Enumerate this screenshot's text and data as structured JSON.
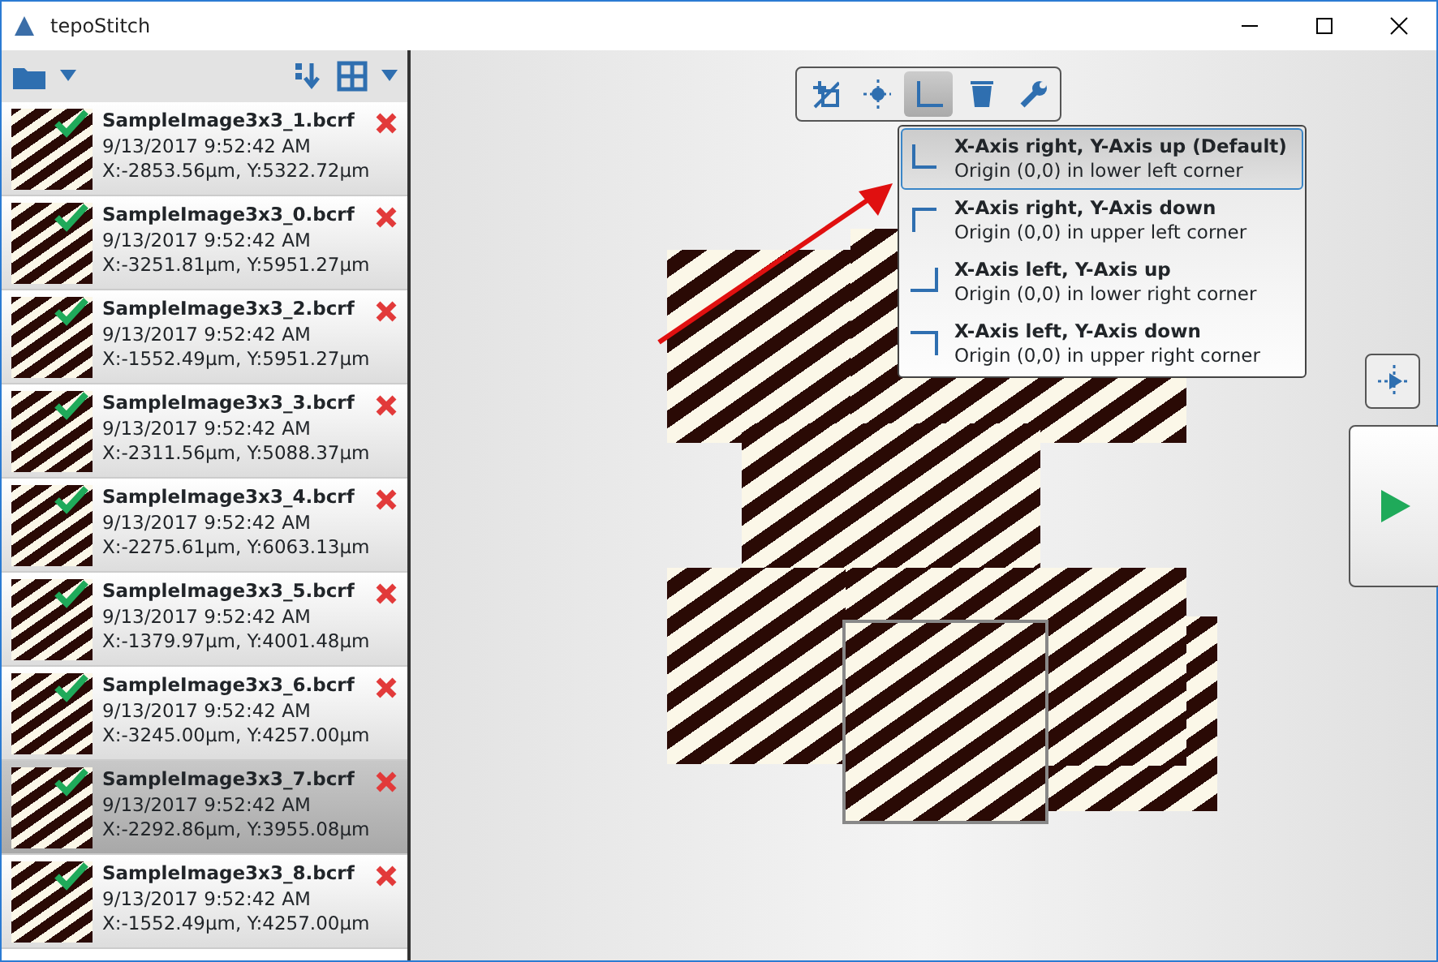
{
  "window": {
    "title": "tepoStitch"
  },
  "images": [
    {
      "name": "SampleImage3x3_1.bcrf",
      "date": "9/13/2017 9:52:42 AM",
      "position": "X:-2853.56µm, Y:5322.72µm",
      "checked": true,
      "selected": false
    },
    {
      "name": "SampleImage3x3_0.bcrf",
      "date": "9/13/2017 9:52:42 AM",
      "position": "X:-3251.81µm, Y:5951.27µm",
      "checked": true,
      "selected": false
    },
    {
      "name": "SampleImage3x3_2.bcrf",
      "date": "9/13/2017 9:52:42 AM",
      "position": "X:-1552.49µm, Y:5951.27µm",
      "checked": true,
      "selected": false
    },
    {
      "name": "SampleImage3x3_3.bcrf",
      "date": "9/13/2017 9:52:42 AM",
      "position": "X:-2311.56µm, Y:5088.37µm",
      "checked": true,
      "selected": false
    },
    {
      "name": "SampleImage3x3_4.bcrf",
      "date": "9/13/2017 9:52:42 AM",
      "position": "X:-2275.61µm, Y:6063.13µm",
      "checked": true,
      "selected": false
    },
    {
      "name": "SampleImage3x3_5.bcrf",
      "date": "9/13/2017 9:52:42 AM",
      "position": "X:-1379.97µm, Y:4001.48µm",
      "checked": true,
      "selected": false
    },
    {
      "name": "SampleImage3x3_6.bcrf",
      "date": "9/13/2017 9:52:42 AM",
      "position": "X:-3245.00µm, Y:4257.00µm",
      "checked": true,
      "selected": false
    },
    {
      "name": "SampleImage3x3_7.bcrf",
      "date": "9/13/2017 9:52:42 AM",
      "position": "X:-2292.86µm, Y:3955.08µm",
      "checked": true,
      "selected": true
    },
    {
      "name": "SampleImage3x3_8.bcrf",
      "date": "9/13/2017 9:52:42 AM",
      "position": "X:-1552.49µm, Y:4257.00µm",
      "checked": true,
      "selected": false
    }
  ],
  "tools": [
    {
      "kind": "no-grid",
      "selected": false
    },
    {
      "kind": "move",
      "selected": false
    },
    {
      "kind": "axes",
      "selected": true
    },
    {
      "kind": "delete",
      "selected": false
    },
    {
      "kind": "settings",
      "selected": false
    }
  ],
  "axis_menu": [
    {
      "kind": "right-up",
      "title": "X-Axis right, Y-Axis up (Default)",
      "subtitle": "Origin (0,0) in lower left corner",
      "selected": true
    },
    {
      "kind": "right-down",
      "title": "X-Axis right, Y-Axis down",
      "subtitle": "Origin (0,0) in upper left corner",
      "selected": false
    },
    {
      "kind": "left-up",
      "title": "X-Axis left, Y-Axis up",
      "subtitle": "Origin (0,0) in lower right corner",
      "selected": false
    },
    {
      "kind": "left-down",
      "title": "X-Axis left, Y-Axis down",
      "subtitle": "Origin (0,0) in upper right corner",
      "selected": false
    }
  ]
}
